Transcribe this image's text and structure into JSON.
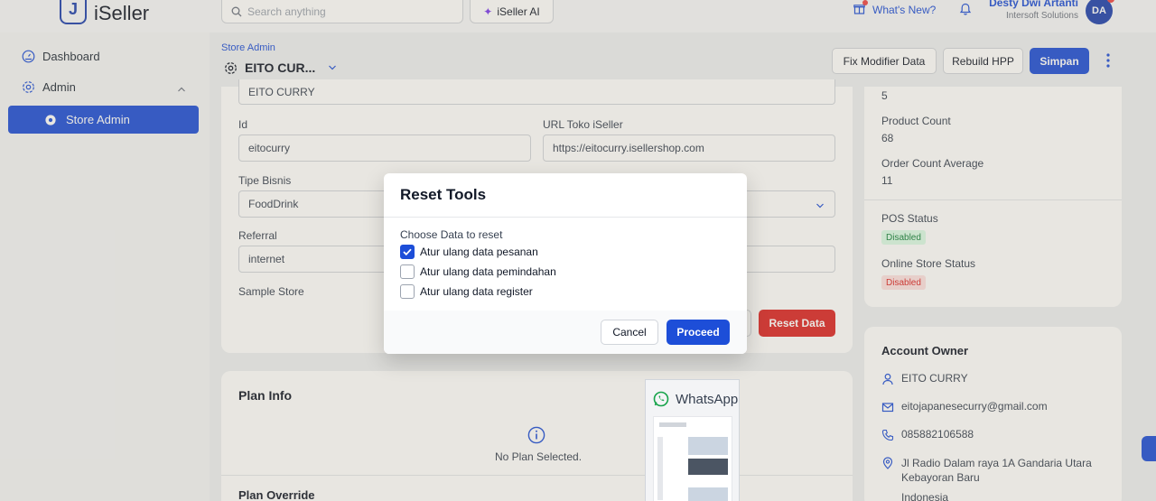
{
  "app": {
    "logo_text": "iSeller",
    "logo_mark": "J"
  },
  "header": {
    "search_placeholder": "Search anything",
    "ai_label": "iSeller AI",
    "whats_new": "What's New?",
    "user_name": "Desty Dwi Artanti",
    "user_org": "Intersoft Solutions",
    "avatar_initials": "DA"
  },
  "sidebar": {
    "items": [
      {
        "label": "Dashboard",
        "icon": "dashboard-icon"
      },
      {
        "label": "Admin",
        "icon": "gear-icon"
      },
      {
        "label": "Store Admin",
        "icon": "gear-icon",
        "active": true
      }
    ]
  },
  "page": {
    "breadcrumb": "Store Admin",
    "title": "EITO CUR...",
    "buttons": {
      "fix_modifier": "Fix Modifier Data",
      "rebuild_hpp": "Rebuild HPP",
      "save": "Simpan"
    }
  },
  "form": {
    "name_value": "EITO CURRY",
    "id_label": "Id",
    "id_value": "eitocurry",
    "url_label": "URL Toko iSeller",
    "url_value": "https://eitocurry.isellershop.com",
    "business_type_label": "Tipe Bisnis",
    "business_type_value": "FoodDrink",
    "referral_label": "Referral",
    "referral_value": "internet",
    "sample_store_label": "Sample Store",
    "reset_data_label": "Reset Data"
  },
  "plan": {
    "title": "Plan Info",
    "empty": "No Plan Selected.",
    "override_title": "Plan Override"
  },
  "stats": {
    "top_value": "5",
    "product_count_label": "Product Count",
    "product_count_value": "68",
    "order_avg_label": "Order Count Average",
    "order_avg_value": "11",
    "pos_status_label": "POS Status",
    "pos_status_value": "Disabled",
    "online_status_label": "Online Store Status",
    "online_status_value": "Disabled"
  },
  "owner": {
    "title": "Account Owner",
    "name": "EITO CURRY",
    "email": "eitojapanesecurry@gmail.com",
    "phone": "085882106588",
    "address": "Jl Radio Dalam raya 1A Gandaria Utara Kebayoran Baru",
    "country": "Indonesia"
  },
  "modal": {
    "title": "Reset Tools",
    "subtitle": "Choose Data to reset",
    "options": [
      {
        "label": "Atur ulang data pesanan",
        "checked": true
      },
      {
        "label": "Atur ulang data pemindahan",
        "checked": false
      },
      {
        "label": "Atur ulang data register",
        "checked": false
      }
    ],
    "cancel": "Cancel",
    "proceed": "Proceed"
  },
  "whatsapp": {
    "label": "WhatsApp"
  },
  "colors": {
    "accent": "#1d4ed8",
    "danger": "#dc2626",
    "success": "#15803d"
  }
}
